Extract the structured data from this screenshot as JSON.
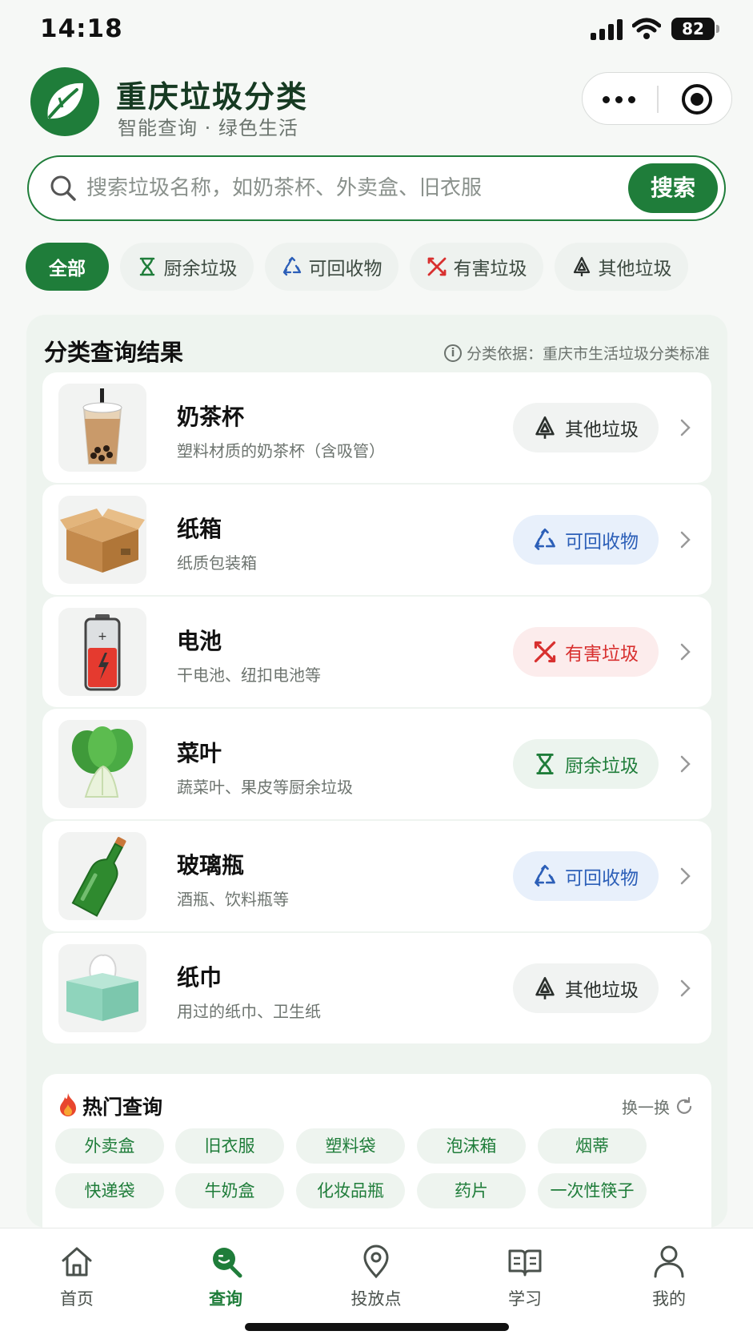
{
  "status_bar": {
    "time": "14:18",
    "battery": "82"
  },
  "header": {
    "title": "重庆垃圾分类",
    "subtitle": "智能查询 · 绿色生活"
  },
  "search": {
    "placeholder": "搜索垃圾名称，如奶茶杯、外卖盒、旧衣服",
    "button_label": "搜索"
  },
  "filters": [
    {
      "label": "全部",
      "icon": null
    },
    {
      "label": "厨余垃圾",
      "icon": "hourglass-icon"
    },
    {
      "label": "可回收物",
      "icon": "recycle-icon"
    },
    {
      "label": "有害垃圾",
      "icon": "hazard-cross-icon"
    },
    {
      "label": "其他垃圾",
      "icon": "other-waste-icon"
    }
  ],
  "results": {
    "title": "分类查询结果",
    "basis": "分类依据：重庆市生活垃圾分类标准",
    "items": [
      {
        "name": "奶茶杯",
        "desc": "塑料材质的奶茶杯（含吸管）",
        "category": "其他垃圾",
        "image": "bubble-tea-cup"
      },
      {
        "name": "纸箱",
        "desc": "纸质包装箱",
        "category": "可回收物",
        "image": "cardboard-box"
      },
      {
        "name": "电池",
        "desc": "干电池、纽扣电池等",
        "category": "有害垃圾",
        "image": "battery"
      },
      {
        "name": "菜叶",
        "desc": "蔬菜叶、果皮等厨余垃圾",
        "category": "厨余垃圾",
        "image": "bok-choy"
      },
      {
        "name": "玻璃瓶",
        "desc": "酒瓶、饮料瓶等",
        "category": "可回收物",
        "image": "glass-bottle"
      },
      {
        "name": "纸巾",
        "desc": "用过的纸巾、卫生纸",
        "category": "其他垃圾",
        "image": "tissue-box"
      }
    ]
  },
  "hot": {
    "title": "热门查询",
    "refresh_label": "换一换",
    "tags": [
      "外卖盒",
      "旧衣服",
      "塑料袋",
      "泡沫箱",
      "烟蒂",
      "快递袋",
      "牛奶盒",
      "化妆品瓶",
      "药片",
      "一次性筷子"
    ]
  },
  "tabbar": [
    {
      "label": "首页",
      "icon": "home-icon"
    },
    {
      "label": "查询",
      "icon": "search-icon"
    },
    {
      "label": "投放点",
      "icon": "location-pin-icon"
    },
    {
      "label": "学习",
      "icon": "book-icon"
    },
    {
      "label": "我的",
      "icon": "user-icon"
    }
  ],
  "colors": {
    "brand": "#1f7d3a",
    "recycle": "#2c5fb8",
    "hazard": "#d8302f",
    "other": "#2a2f2c"
  }
}
